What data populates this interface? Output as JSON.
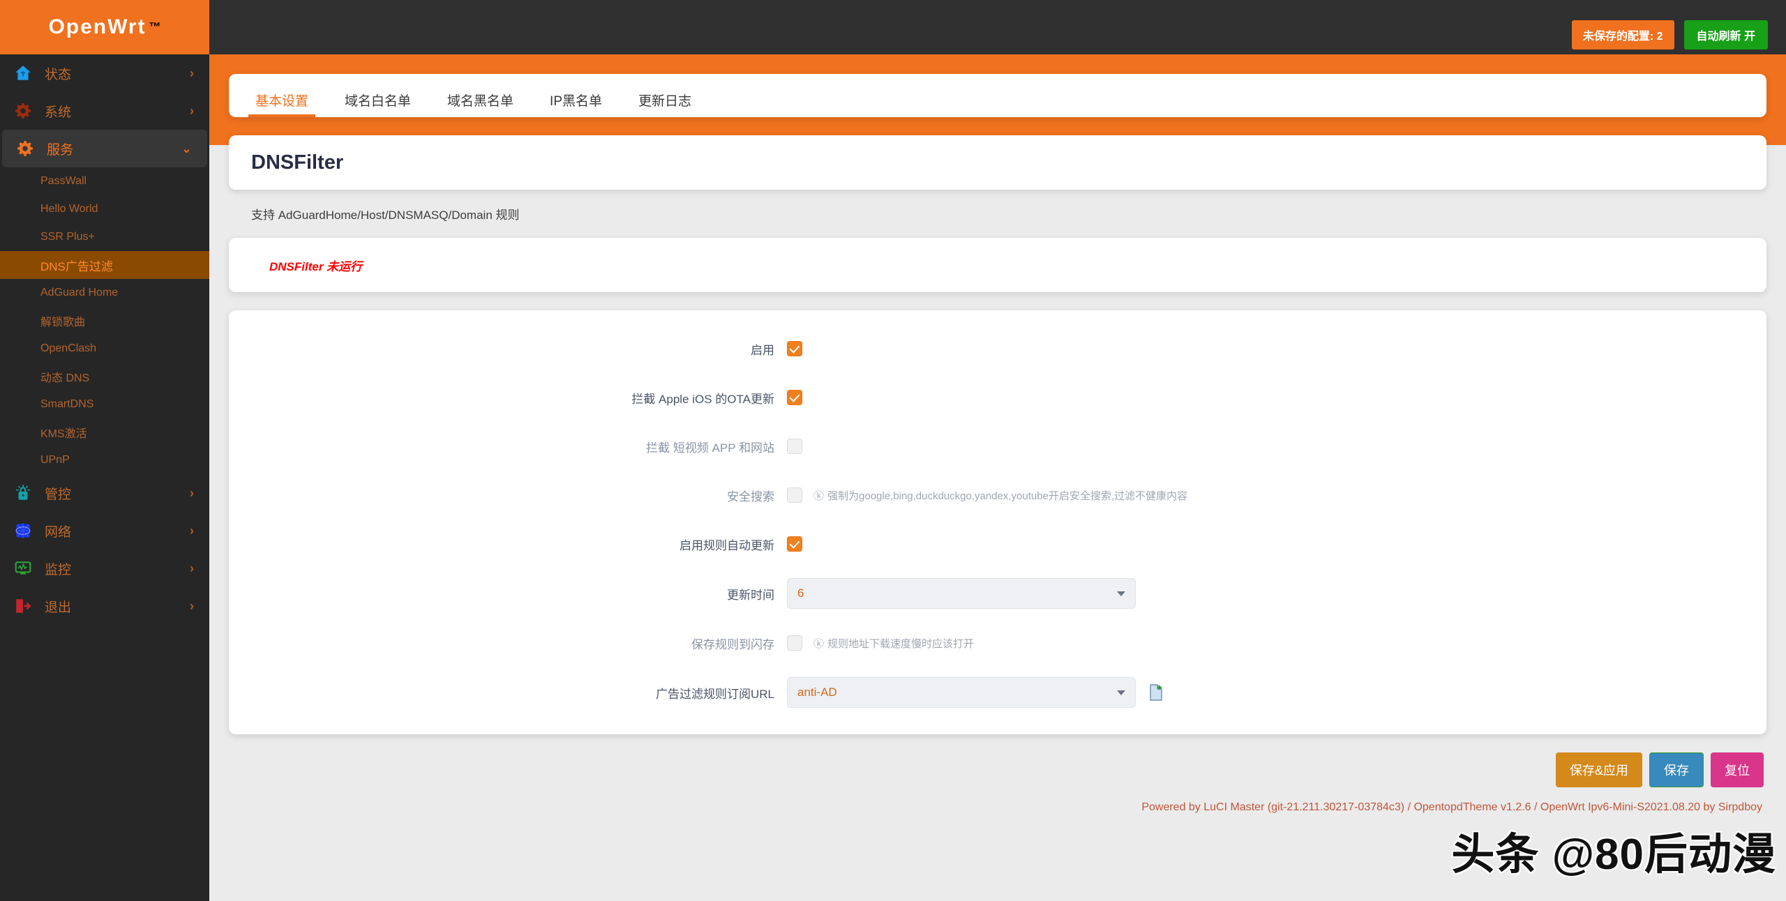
{
  "brand": {
    "name": "OpenWrt",
    "tm": "™"
  },
  "topbar": {
    "unsaved_label": "未保存的配置: 2",
    "autorefresh_label": "自动刷新 开"
  },
  "sidebar": {
    "groups": [
      {
        "label": "状态",
        "icon": "house-icon",
        "chevron": "›",
        "expanded": false,
        "items": []
      },
      {
        "label": "系统",
        "icon": "gear-dark-icon",
        "chevron": "›",
        "expanded": false,
        "items": []
      },
      {
        "label": "服务",
        "icon": "gear-orange-icon",
        "chevron": "⌄",
        "expanded": true,
        "items": [
          {
            "label": "PassWall",
            "active": false
          },
          {
            "label": "Hello World",
            "active": false
          },
          {
            "label": "SSR Plus+",
            "active": false
          },
          {
            "label": "DNS广告过滤",
            "active": true
          },
          {
            "label": "AdGuard Home",
            "active": false
          },
          {
            "label": "解锁歌曲",
            "active": false
          },
          {
            "label": "OpenClash",
            "active": false
          },
          {
            "label": "动态 DNS",
            "active": false
          },
          {
            "label": "SmartDNS",
            "active": false
          },
          {
            "label": "KMS激活",
            "active": false
          },
          {
            "label": "UPnP",
            "active": false
          }
        ]
      },
      {
        "label": "管控",
        "icon": "lock-alarm-icon",
        "chevron": "›",
        "expanded": false,
        "items": []
      },
      {
        "label": "网络",
        "icon": "network-icon",
        "chevron": "›",
        "expanded": false,
        "items": []
      },
      {
        "label": "监控",
        "icon": "monitor-chart-icon",
        "chevron": "›",
        "expanded": false,
        "items": []
      },
      {
        "label": "退出",
        "icon": "logout-icon",
        "chevron": "›",
        "expanded": false,
        "items": []
      }
    ]
  },
  "tabs": [
    {
      "label": "基本设置",
      "active": true
    },
    {
      "label": "域名白名单",
      "active": false
    },
    {
      "label": "域名黑名单",
      "active": false
    },
    {
      "label": "IP黑名单",
      "active": false
    },
    {
      "label": "更新日志",
      "active": false
    }
  ],
  "page": {
    "title": "DNSFilter",
    "description": "支持 AdGuardHome/Host/DNSMASQ/Domain 规则",
    "status": "DNSFilter 未运行"
  },
  "form": {
    "rows": [
      {
        "type": "checkbox",
        "label": "启用",
        "checked": true,
        "dim": false,
        "hint": ""
      },
      {
        "type": "checkbox",
        "label": "拦截 Apple iOS 的OTA更新",
        "checked": true,
        "dim": false,
        "hint": ""
      },
      {
        "type": "checkbox",
        "label": "拦截 短视频 APP 和网站",
        "checked": false,
        "dim": true,
        "hint": ""
      },
      {
        "type": "checkbox",
        "label": "安全搜索",
        "checked": false,
        "dim": true,
        "hint": "强制为google,bing,duckduckgo,yandex,youtube开启安全搜索,过滤不健康内容"
      },
      {
        "type": "checkbox",
        "label": "启用规则自动更新",
        "checked": true,
        "dim": false,
        "hint": ""
      },
      {
        "type": "select",
        "label": "更新时间",
        "value": "6",
        "dim": false,
        "hint": "",
        "extra_icon": ""
      },
      {
        "type": "checkbox",
        "label": "保存规则到闪存",
        "checked": false,
        "dim": true,
        "hint": "规则地址下载速度慢时应该打开"
      },
      {
        "type": "select",
        "label": "广告过滤规则订阅URL",
        "value": "anti-AD",
        "dim": false,
        "hint": "",
        "extra_icon": "new-document-icon"
      }
    ],
    "hint_icon": "ⓚ"
  },
  "actions": {
    "apply_label": "保存&应用",
    "save_label": "保存",
    "reset_label": "复位"
  },
  "footer": {
    "text": "Powered by LuCI Master (git-21.211.30217-03784c3) / OpentopdTheme v1.2.6 / OpenWrt Ipv6-Mini-S2021.08.20 by Sirpdboy"
  },
  "watermark": {
    "text": "头条 @80后动漫"
  },
  "colors": {
    "brand_orange": "#f0711e",
    "sidebar_dark": "#262626",
    "active_submenu": "#8a4a00",
    "green": "#18a018",
    "status_red": "#ff0000",
    "title_navy": "#292c45",
    "footer_red": "#c0563b"
  }
}
